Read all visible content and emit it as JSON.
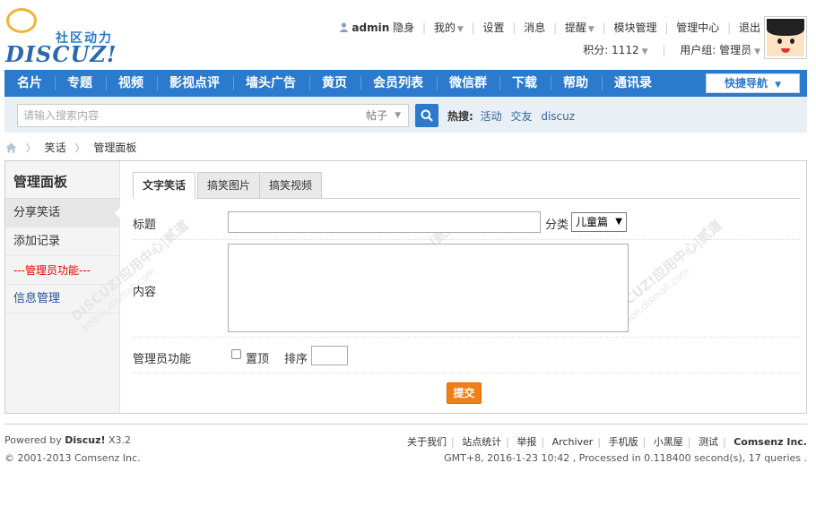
{
  "logo": {
    "cn": "社区动力",
    "en": "DISCUZ!"
  },
  "userbar": {
    "username": "admin",
    "items": [
      "隐身",
      "我的",
      "设置",
      "消息",
      "提醒",
      "模块管理",
      "管理中心",
      "退出"
    ],
    "points": "积分: 1112",
    "usergroup": "用户组: 管理员"
  },
  "nav": {
    "items": [
      "名片",
      "专题",
      "视频",
      "影视点评",
      "墙头广告",
      "黄页",
      "会员列表",
      "微信群",
      "下载",
      "帮助",
      "通讯录"
    ],
    "quick": "快捷导航"
  },
  "search": {
    "placeholder": "请输入搜索内容",
    "type": "帖子",
    "hot_label": "热搜:",
    "hot": [
      "活动",
      "交友",
      "discuz"
    ]
  },
  "breadcrumb": [
    "笑话",
    "管理面板"
  ],
  "sidebar": {
    "title": "管理面板",
    "items": [
      "分享笑话",
      "添加记录",
      "---管理员功能---",
      "信息管理"
    ]
  },
  "tabs": [
    "文字笑话",
    "搞笑图片",
    "搞笑视频"
  ],
  "form": {
    "title_label": "标题",
    "category_label": "分类",
    "category_value": "儿童篇",
    "content_label": "内容",
    "admin_label": "管理员功能",
    "sticky_label": "置顶",
    "sort_label": "排序",
    "submit": "提交"
  },
  "watermark": {
    "brand": "DISCUZ!应用中心|贰道",
    "url": "addon.dismall.com"
  },
  "footer": {
    "powered_prefix": "Powered by ",
    "powered_brand": "Discuz!",
    "powered_ver": " X3.2",
    "copyright": "© 2001-2013 Comsenz Inc.",
    "links": [
      "关于我们",
      "站点统计",
      "举报",
      "Archiver",
      "手机版",
      "小黑屋",
      "测试"
    ],
    "company": "Comsenz Inc.",
    "stats": "GMT+8, 2016-1-23 10:42 , Processed in 0.118400 second(s), 17 queries ."
  },
  "colors": {
    "nav_bg": "#2b7acd",
    "submit_bg": "#f07e1b",
    "admin_text": "#e00000"
  }
}
